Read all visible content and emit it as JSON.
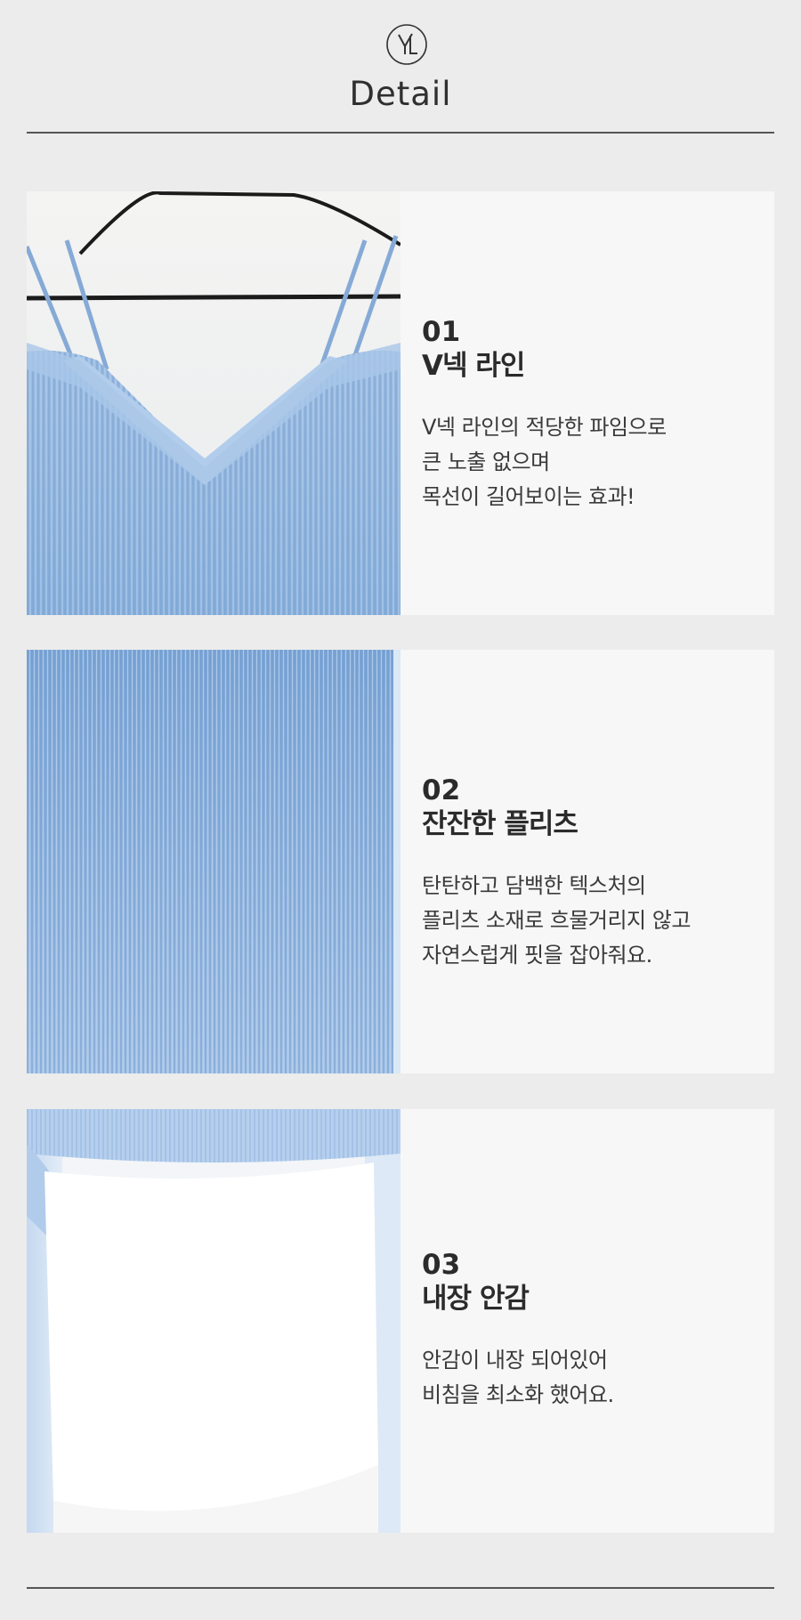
{
  "header": {
    "logo_icon": "monogram-logo-icon",
    "title": "Detail"
  },
  "sections": [
    {
      "number": "01",
      "heading": "V넥 라인",
      "description": [
        "V넥 라인의 적당한 파임으로",
        "큰 노출 없으며",
        "목선이 길어보이는 효과!"
      ],
      "photo": "dress-neckline-photo"
    },
    {
      "number": "02",
      "heading": "잔잔한 플리츠",
      "description": [
        "탄탄하고 담백한 텍스처의",
        "플리츠 소재로 흐물거리지 않고",
        "자연스럽게 핏을 잡아줘요."
      ],
      "photo": "pleats-texture-photo"
    },
    {
      "number": "03",
      "heading": "내장 안감",
      "description": [
        "안감이 내장 되어있어",
        "비침을 최소화 했어요."
      ],
      "photo": "inner-lining-photo"
    }
  ],
  "colors": {
    "background": "#ececec",
    "panel": "#f7f7f7",
    "dress_blue": "#8fb3dc",
    "rule": "#555555"
  }
}
